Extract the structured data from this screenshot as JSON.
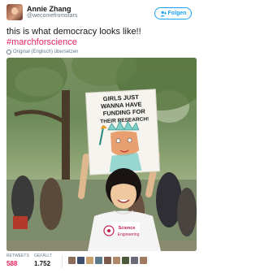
{
  "user": {
    "name": "Annie Zhang",
    "handle": "@wecomefromstars"
  },
  "follow_button": {
    "label": "Folgen"
  },
  "tweet": {
    "text": "this is what democracy looks like!!",
    "hashtag": "#marchforscience"
  },
  "translate": {
    "label": "Original (Englisch) übersetzen"
  },
  "photo": {
    "sign_lines": [
      "GIRLS JUST",
      "WANNA HAVE",
      "FUNDING FOR",
      "THEIR RESEARCH!"
    ],
    "shirt_text_1": "Science",
    "shirt_text_2": "Engineering"
  },
  "stats": {
    "retweets_label": "RETWEETS",
    "retweets_value": "588",
    "likes_label": "GEFÄLLT",
    "likes_value": "1.752"
  },
  "colors": {
    "accent": "#1da1f2",
    "hashtag": "#e0245e",
    "retweets": "#e0245e"
  },
  "liker_colors": [
    "#8a6d5a",
    "#3d4f6b",
    "#c8a070",
    "#5c7a8a",
    "#7a5a4a",
    "#b08868",
    "#4a5a3a",
    "#6a6a7a",
    "#a07a60"
  ]
}
